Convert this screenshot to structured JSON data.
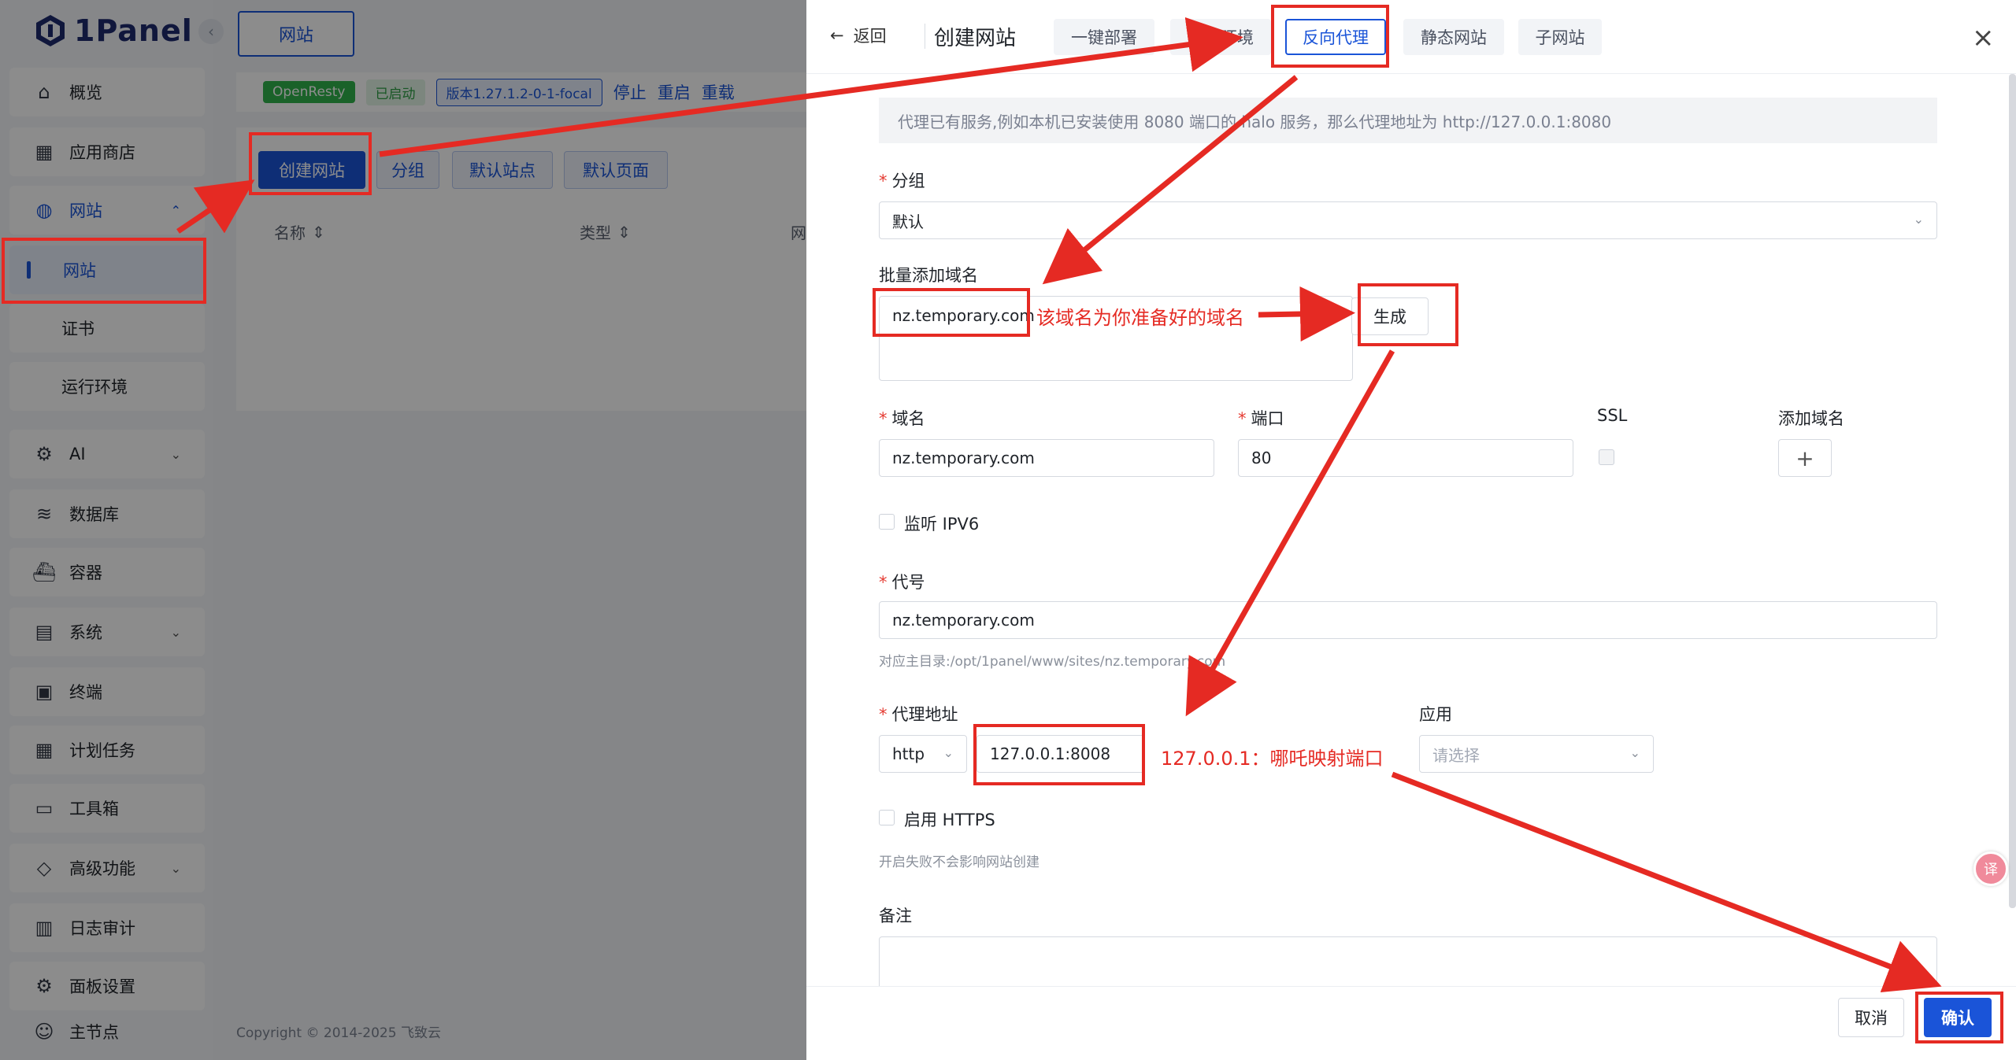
{
  "app": {
    "logo_text": "1Panel",
    "sidebar": {
      "items": [
        {
          "label": "概览",
          "icon": "home-icon"
        },
        {
          "label": "应用商店",
          "icon": "grid-icon"
        },
        {
          "label": "网站",
          "icon": "globe-icon"
        },
        {
          "label": "网站",
          "icon": "active-bar"
        },
        {
          "label": "证书",
          "icon": ""
        },
        {
          "label": "运行环境",
          "icon": ""
        },
        {
          "label": "AI",
          "icon": "robot-icon"
        },
        {
          "label": "数据库",
          "icon": "layers-icon"
        },
        {
          "label": "容器",
          "icon": "docker-icon"
        },
        {
          "label": "系统",
          "icon": "server-icon"
        },
        {
          "label": "终端",
          "icon": "terminal-icon"
        },
        {
          "label": "计划任务",
          "icon": "calendar-icon"
        },
        {
          "label": "工具箱",
          "icon": "toolbox-icon"
        },
        {
          "label": "高级功能",
          "icon": "diamond-icon"
        },
        {
          "label": "日志审计",
          "icon": "log-icon"
        },
        {
          "label": "面板设置",
          "icon": "gear-icon"
        },
        {
          "label": "主节点",
          "icon": "user-icon"
        }
      ]
    },
    "top_tab": "网站",
    "status": {
      "openresty": "OpenResty",
      "running": "已启动",
      "version": "版本1.27.1.2-0-1-focal",
      "stop": "停止",
      "restart": "重启",
      "reload": "重载"
    },
    "toolbar": {
      "create": "创建网站",
      "group": "分组",
      "default_site": "默认站点",
      "default_page": "默认页面"
    },
    "table_headers": [
      "名称",
      "类型",
      "网"
    ],
    "footer": "Copyright © 2014-2025 飞致云"
  },
  "drawer": {
    "back": "返回",
    "title": "创建网站",
    "tabs": [
      "一键部署",
      "运行环境",
      "反向代理",
      "静态网站",
      "子网站"
    ],
    "active_tab": "反向代理",
    "info": "代理已有服务,例如本机已安装使用 8080 端口的 halo 服务，那么代理地址为 http://127.0.0.1:8080",
    "group": {
      "label": "分组",
      "value": "默认"
    },
    "batch_domains": {
      "label": "批量添加域名",
      "value": "nz.temporary.com",
      "generate": "生成"
    },
    "domain_row": {
      "domain_label": "域名",
      "domain_value": "nz.temporary.com",
      "port_label": "端口",
      "port_value": "80",
      "ssl_label": "SSL",
      "add_label": "添加域名",
      "add_symbol": "+"
    },
    "ipv6": "监听 IPV6",
    "alias": {
      "label": "代号",
      "value": "nz.temporary.com",
      "hint": "对应主目录:/opt/1panel/www/sites/nz.temporary.com"
    },
    "proxy": {
      "label": "代理地址",
      "scheme": "http",
      "address": "127.0.0.1:8008"
    },
    "app": {
      "label": "应用",
      "placeholder": "请选择"
    },
    "https": {
      "label": "启用 HTTPS",
      "hint": "开启失败不会影响网站创建"
    },
    "remark": {
      "label": "备注"
    },
    "cancel": "取消",
    "confirm": "确认"
  },
  "annotations": {
    "domain_note": "该域名为你准备好的域名",
    "proxy_note": "127.0.0.1：哪吒映射端口"
  },
  "colors": {
    "accent": "#1a54d8",
    "annotation": "#e52a23",
    "required": "#e53b32"
  }
}
